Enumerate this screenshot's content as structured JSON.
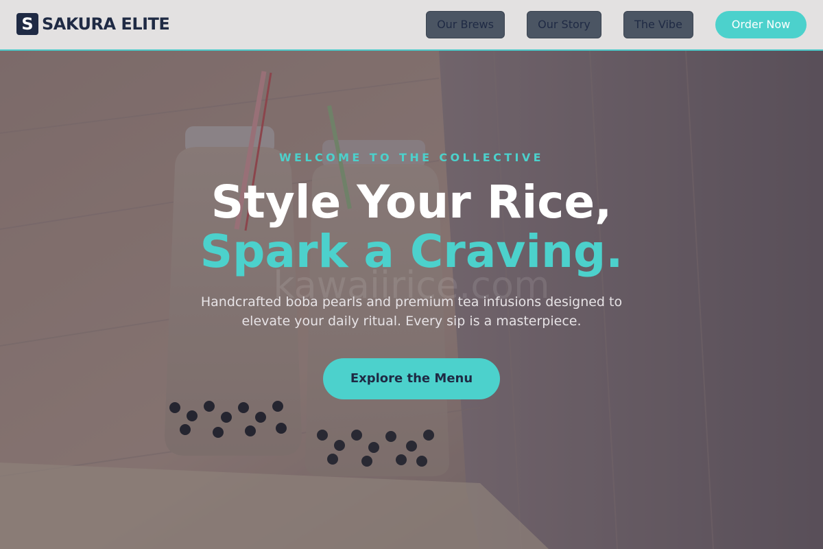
{
  "header": {
    "logo_letter": "S",
    "brand_name": "SAKURA ELITE",
    "nav": [
      {
        "label": "Our Brews"
      },
      {
        "label": "Our Story"
      },
      {
        "label": "The Vibe"
      }
    ],
    "order_label": "Order Now"
  },
  "hero": {
    "eyebrow": "WELCOME TO THE COLLECTIVE",
    "title_line1": "Style Your Rice,",
    "title_line2": "Spark a Craving.",
    "watermark": "kawaiirice.com",
    "subtitle": "Handcrafted boba pearls and premium tea infusions designed to elevate your daily ritual. Every sip is a masterpiece.",
    "cta_label": "Explore the Menu"
  },
  "colors": {
    "accent": "#4cd1cc",
    "navy": "#1f2a44",
    "nav_button_bg": "#4b5563",
    "header_bg": "#e3e1e1"
  }
}
